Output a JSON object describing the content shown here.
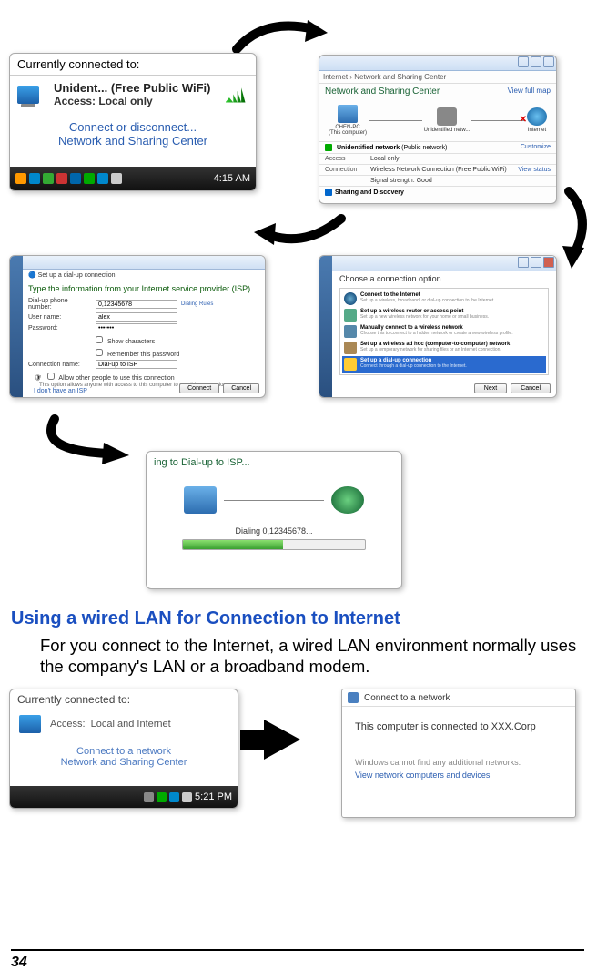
{
  "s1": {
    "title": "Currently connected to:",
    "network_name": "Unident... (Free Public WiFi)",
    "access_label": "Access:",
    "access_value": "Local only",
    "link1": "Connect or disconnect...",
    "link2": "Network and Sharing Center",
    "time": "4:15 AM"
  },
  "s2": {
    "breadcrumb": "Internet › Network and Sharing Center",
    "title": "Network and Sharing Center",
    "view_full": "View full map",
    "node_pc": "CHEN-PC",
    "node_pc_sub": "(This computer)",
    "node_unid": "Unidentified netw...",
    "node_internet": "Internet",
    "net_name": "Unidentified network",
    "net_type": "(Public network)",
    "customize": "Customize",
    "access_lbl": "Access",
    "access_val": "Local only",
    "conn_lbl": "Connection",
    "conn_val": "Wireless Network Connection (Free Public WiFi)",
    "view_status": "View status",
    "signal_lbl": "Signal strength:",
    "signal_val": "Good",
    "sharing": "Sharing and Discovery"
  },
  "s3": {
    "header_icon_label": "Set up a dial-up connection",
    "header": "Type the information from your Internet service provider (ISP)",
    "phone_lbl": "Dial-up phone number:",
    "phone_val": "0,12345678",
    "dialing_rules": "Dialing Rules",
    "user_lbl": "User name:",
    "user_val": "alex",
    "pwd_lbl": "Password:",
    "pwd_val": "•••••••",
    "cb_show": "Show characters",
    "cb_remember": "Remember this password",
    "conn_lbl": "Connection name:",
    "conn_val": "Dial-up to ISP",
    "cb_allow": "Allow other people to use this connection",
    "allow_note": "This option allows anyone with access to this computer to use this connection.",
    "no_isp": "I don't have an ISP",
    "btn_connect": "Connect",
    "btn_cancel": "Cancel"
  },
  "s4": {
    "header": "Choose a connection option",
    "opt1_t": "Connect to the Internet",
    "opt1_d": "Set up a wireless, broadband, or dial-up connection to the Internet.",
    "opt2_t": "Set up a wireless router or access point",
    "opt2_d": "Set up a new wireless network for your home or small business.",
    "opt3_t": "Manually connect to a wireless network",
    "opt3_d": "Choose this to connect to a hidden network or create a new wireless profile.",
    "opt4_t": "Set up a wireless ad hoc (computer-to-computer) network",
    "opt4_d": "Set up a temporary network for sharing files or an Internet connection.",
    "opt5_t": "Set up a dial-up connection",
    "opt5_d": "Connect through a dial-up connection to the Internet.",
    "btn_next": "Next",
    "btn_cancel": "Cancel"
  },
  "s5": {
    "header": "ing to Dial-up to ISP...",
    "status": "Dialing 0,12345678..."
  },
  "heading": "Using a wired LAN for Connection to Internet",
  "para": "For you connect to the Internet, a wired LAN environment normally uses the company's LAN or a broadband modem.",
  "s6": {
    "title": "Currently connected to:",
    "access_label": "Access:",
    "access_value": "Local and Internet",
    "link1": "Connect to a network",
    "link2": "Network and Sharing Center",
    "time": "5:21 PM"
  },
  "s7": {
    "title": "Connect to a network",
    "msg": "This computer is connected to XXX.Corp",
    "msg2": "Windows cannot find any additional networks.",
    "link": "View network computers and devices"
  },
  "page_num": "34"
}
